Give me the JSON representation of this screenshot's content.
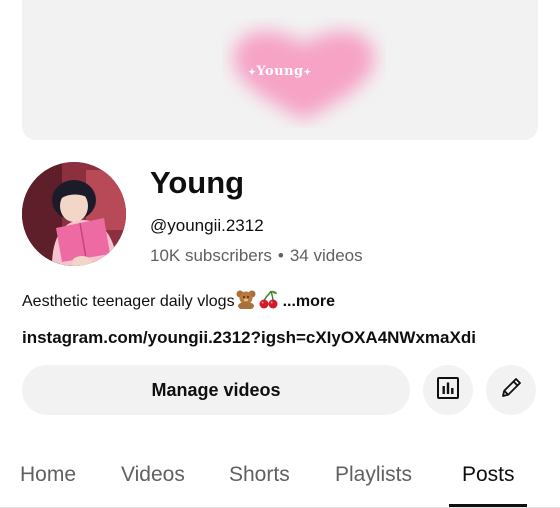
{
  "banner": {
    "text": "Young"
  },
  "channel": {
    "title": "Young",
    "handle": "@youngii.2312",
    "subscribers": "10K subscribers",
    "separator": "•",
    "videos": "34 videos"
  },
  "description": {
    "text": "Aesthetic teenager daily vlogs",
    "more_label": "...more",
    "emojis": [
      "teddy-bear",
      "cherries"
    ]
  },
  "link": {
    "text": "instagram.com/youngii.2312?igsh=cXIyOXA4NWxmaXdi"
  },
  "actions": {
    "manage_label": "Manage videos",
    "analytics_icon": "analytics-icon",
    "edit_icon": "pencil-icon"
  },
  "tabs": [
    {
      "label": "Home"
    },
    {
      "label": "Videos"
    },
    {
      "label": "Shorts"
    },
    {
      "label": "Playlists"
    },
    {
      "label": "Posts",
      "active": true
    }
  ],
  "colors": {
    "accent_pink": "#f6a3c6",
    "muted_text": "#606060",
    "button_bg": "#f2f2f2"
  }
}
